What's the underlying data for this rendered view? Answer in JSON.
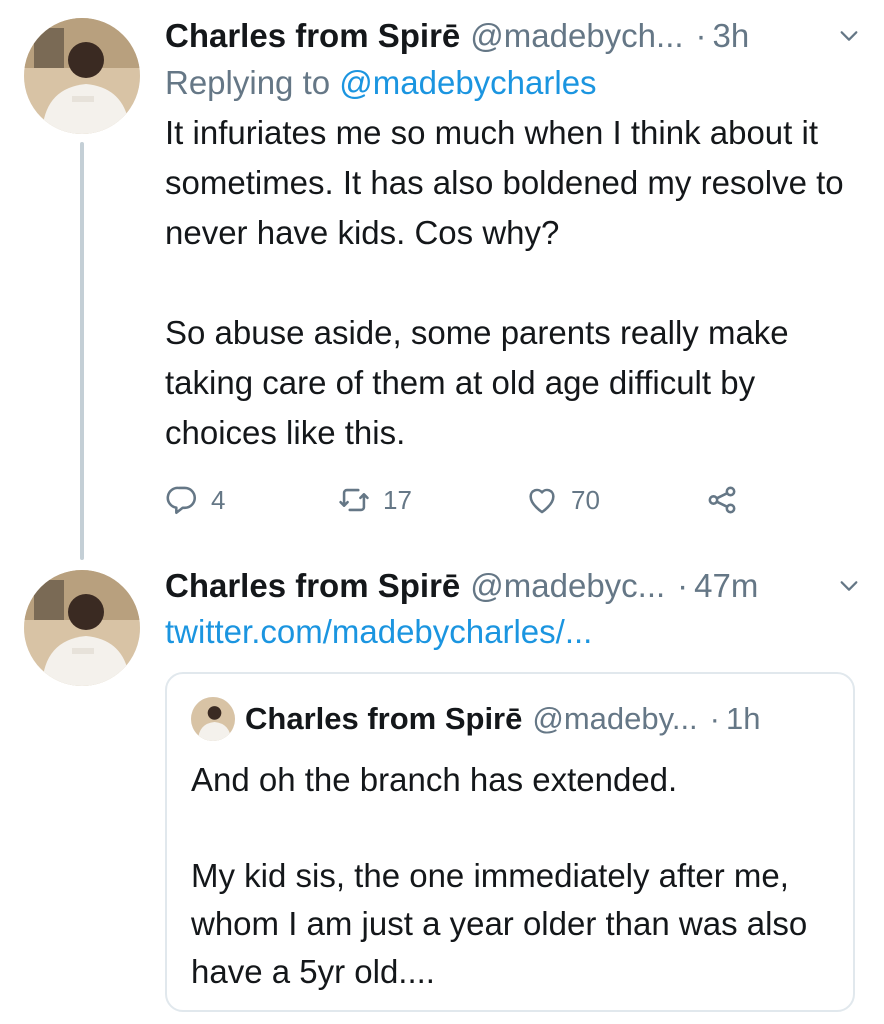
{
  "tweets": [
    {
      "author_name": "Charles from Spirē",
      "handle": "@madebych...",
      "separator": "·",
      "time": "3h",
      "replying_to_prefix": "Replying to",
      "replying_to_handle": "@madebycharles",
      "paragraphs": [
        "It infuriates me so much when I think about it sometimes. It has also boldened my resolve to never have kids. Cos why?",
        "So abuse aside, some parents really make taking care of them at old age difficult by choices like this."
      ],
      "reply_count": "4",
      "retweet_count": "17",
      "like_count": "70"
    },
    {
      "author_name": "Charles from Spirē",
      "handle": "@madebyc...",
      "separator": "·",
      "time": "47m",
      "link_text": "twitter.com/madebycharles/...",
      "quoted": {
        "author_name": "Charles from Spirē",
        "handle": "@madeby...",
        "separator": "·",
        "time": "1h",
        "paragraphs": [
          "And oh the branch has extended.",
          "My kid sis, the one immediately after me, whom I am just a year older than was also have a 5yr old...."
        ]
      }
    }
  ],
  "icons": {
    "more": "chevron-down-icon",
    "reply": "reply-icon",
    "retweet": "retweet-icon",
    "like": "heart-icon",
    "share": "share-icon"
  },
  "colors": {
    "link": "#1b95e0",
    "muted": "#657786",
    "text": "#14171a",
    "thread_line": "#c4cfd6",
    "border": "#e1e8ed"
  }
}
